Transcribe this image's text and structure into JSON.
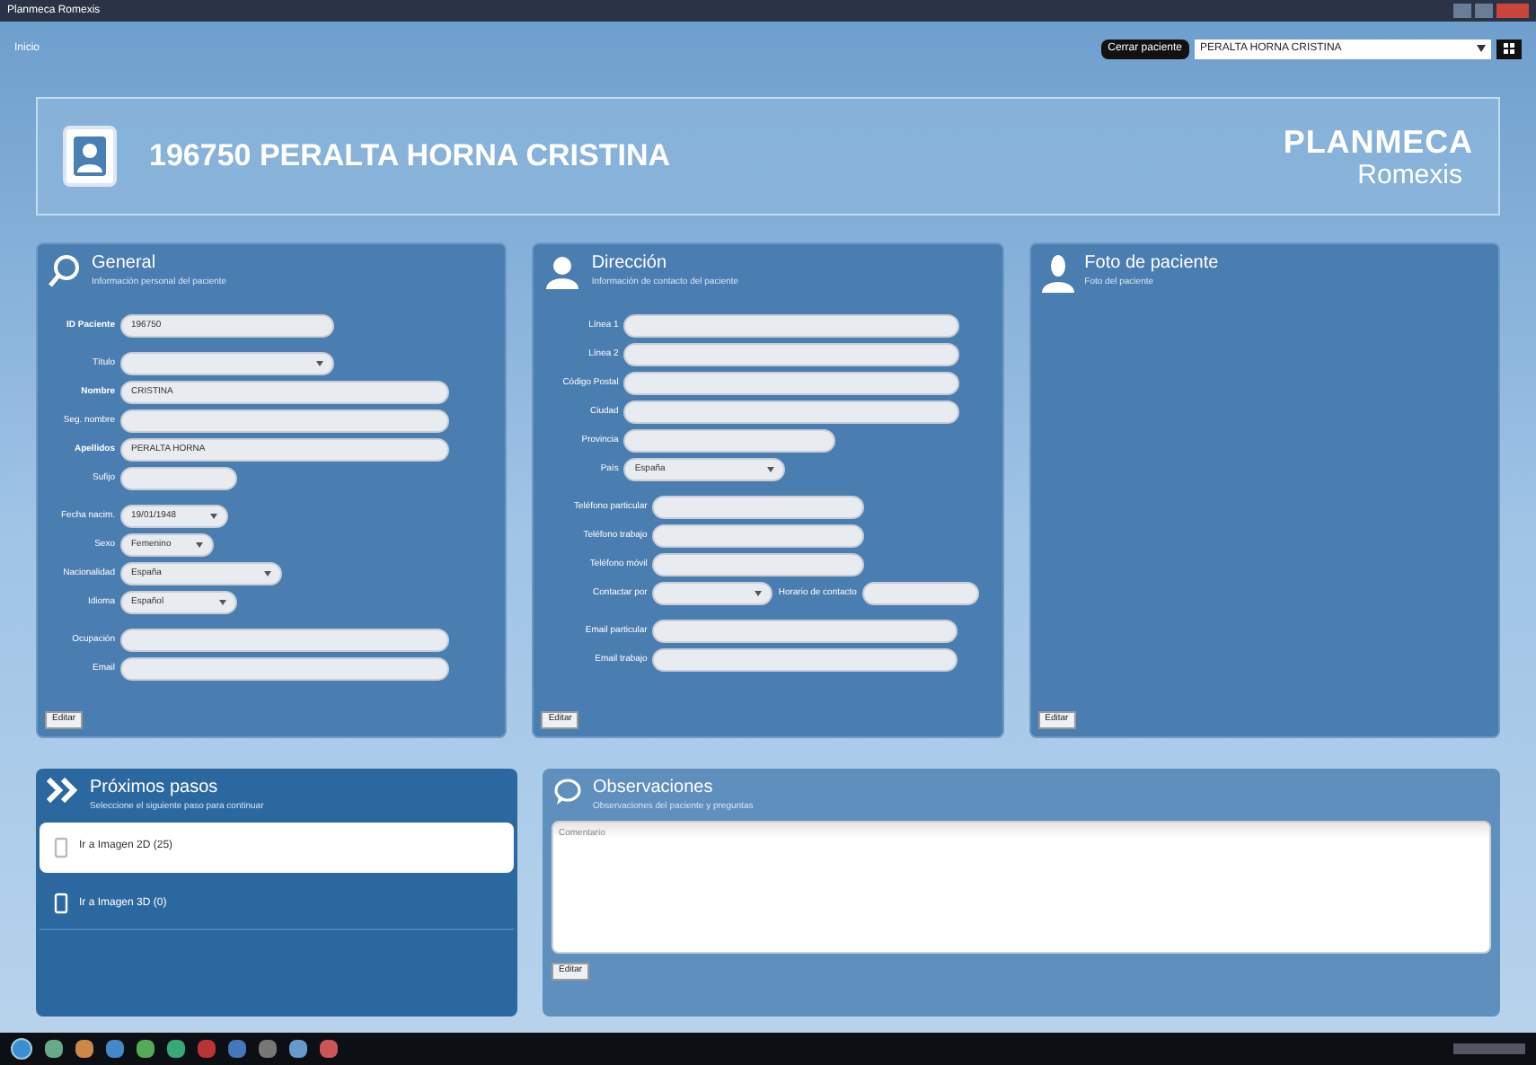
{
  "window": {
    "title": "Planmeca Romexis"
  },
  "toolbar": {
    "home_link": "Inicio",
    "close_patient_button": "Cerrar paciente",
    "patient_select": "PERALTA HORNA CRISTINA"
  },
  "patient_header": {
    "name": "196750 PERALTA HORNA CRISTINA",
    "logo": "PLANMECA",
    "product": "Romexis"
  },
  "general": {
    "title": "General",
    "subtitle": "Información personal del paciente",
    "edit_button": "Editar",
    "groups": [
      [
        [
          {
            "label": "ID Paciente",
            "value": "196750",
            "kind": "text",
            "required": true
          }
        ]
      ],
      [
        [
          {
            "label": "Título",
            "kind": "select",
            "required": false
          }
        ],
        [
          {
            "label": "Nombre",
            "value": "CRISTINA",
            "kind": "text",
            "required": true
          }
        ],
        [
          {
            "label": "Seg. nombre",
            "kind": "text",
            "required": false
          }
        ],
        [
          {
            "label": "Apellidos",
            "value": "PERALTA HORNA",
            "kind": "text",
            "required": true
          }
        ],
        [
          {
            "label": "Sufijo",
            "kind": "text",
            "required": false
          }
        ]
      ],
      [
        [
          {
            "label": "Fecha nacim.",
            "value": "19/01/1948",
            "kind": "select",
            "required": false
          }
        ],
        [
          {
            "label": "Sexo",
            "value": "Femenino",
            "kind": "select",
            "required": false
          }
        ],
        [
          {
            "label": "Nacionalidad",
            "value": "España",
            "kind": "select",
            "required": false
          }
        ],
        [
          {
            "label": "Idioma",
            "value": "Español",
            "kind": "select",
            "required": false
          }
        ]
      ],
      [
        [
          {
            "label": "Ocupación",
            "kind": "text",
            "required": false
          }
        ],
        [
          {
            "label": "Email",
            "kind": "text",
            "required": false
          }
        ]
      ]
    ]
  },
  "address": {
    "title": "Dirección",
    "subtitle": "Información de contacto del paciente",
    "edit_button": "Editar",
    "groups": [
      [
        [
          {
            "label": "Línea 1",
            "kind": "text",
            "required": false
          }
        ],
        [
          {
            "label": "Línea 2",
            "kind": "text",
            "required": false
          }
        ],
        [
          {
            "label": "Código Postal",
            "kind": "text",
            "required": false
          }
        ],
        [
          {
            "label": "Ciudad",
            "kind": "text",
            "required": false
          }
        ],
        [
          {
            "label": "Provincia",
            "kind": "text",
            "required": false
          }
        ],
        [
          {
            "label": "País",
            "value": "España",
            "kind": "select",
            "required": false
          }
        ]
      ],
      [
        [
          {
            "label": "Teléfono particular",
            "kind": "text",
            "required": false
          }
        ],
        [
          {
            "label": "Teléfono trabajo",
            "kind": "text",
            "required": false
          }
        ],
        [
          {
            "label": "Teléfono móvil",
            "kind": "text",
            "required": false
          }
        ],
        [
          {
            "label": "Contactar por",
            "kind": "select",
            "required": false
          },
          {
            "label": "Horario de contacto",
            "kind": "text",
            "required": false
          }
        ]
      ],
      [
        [
          {
            "label": "Email particular",
            "kind": "text",
            "required": false
          }
        ],
        [
          {
            "label": "Email trabajo",
            "kind": "text",
            "required": false
          }
        ]
      ]
    ]
  },
  "photo": {
    "title": "Foto de paciente",
    "subtitle": "Foto del paciente",
    "edit_button": "Editar"
  },
  "next_steps": {
    "title": "Próximos pasos",
    "subtitle": "Seleccione el siguiente paso para continuar",
    "items": [
      {
        "label": "Ir a Imagen 2D (25)",
        "selected": true
      },
      {
        "label": "Ir a Imagen 3D (0)",
        "selected": false
      }
    ]
  },
  "observations": {
    "title": "Observaciones",
    "subtitle": "Observaciones del paciente y preguntas",
    "placeholder": "Comentario",
    "edit_button": "Editar"
  }
}
